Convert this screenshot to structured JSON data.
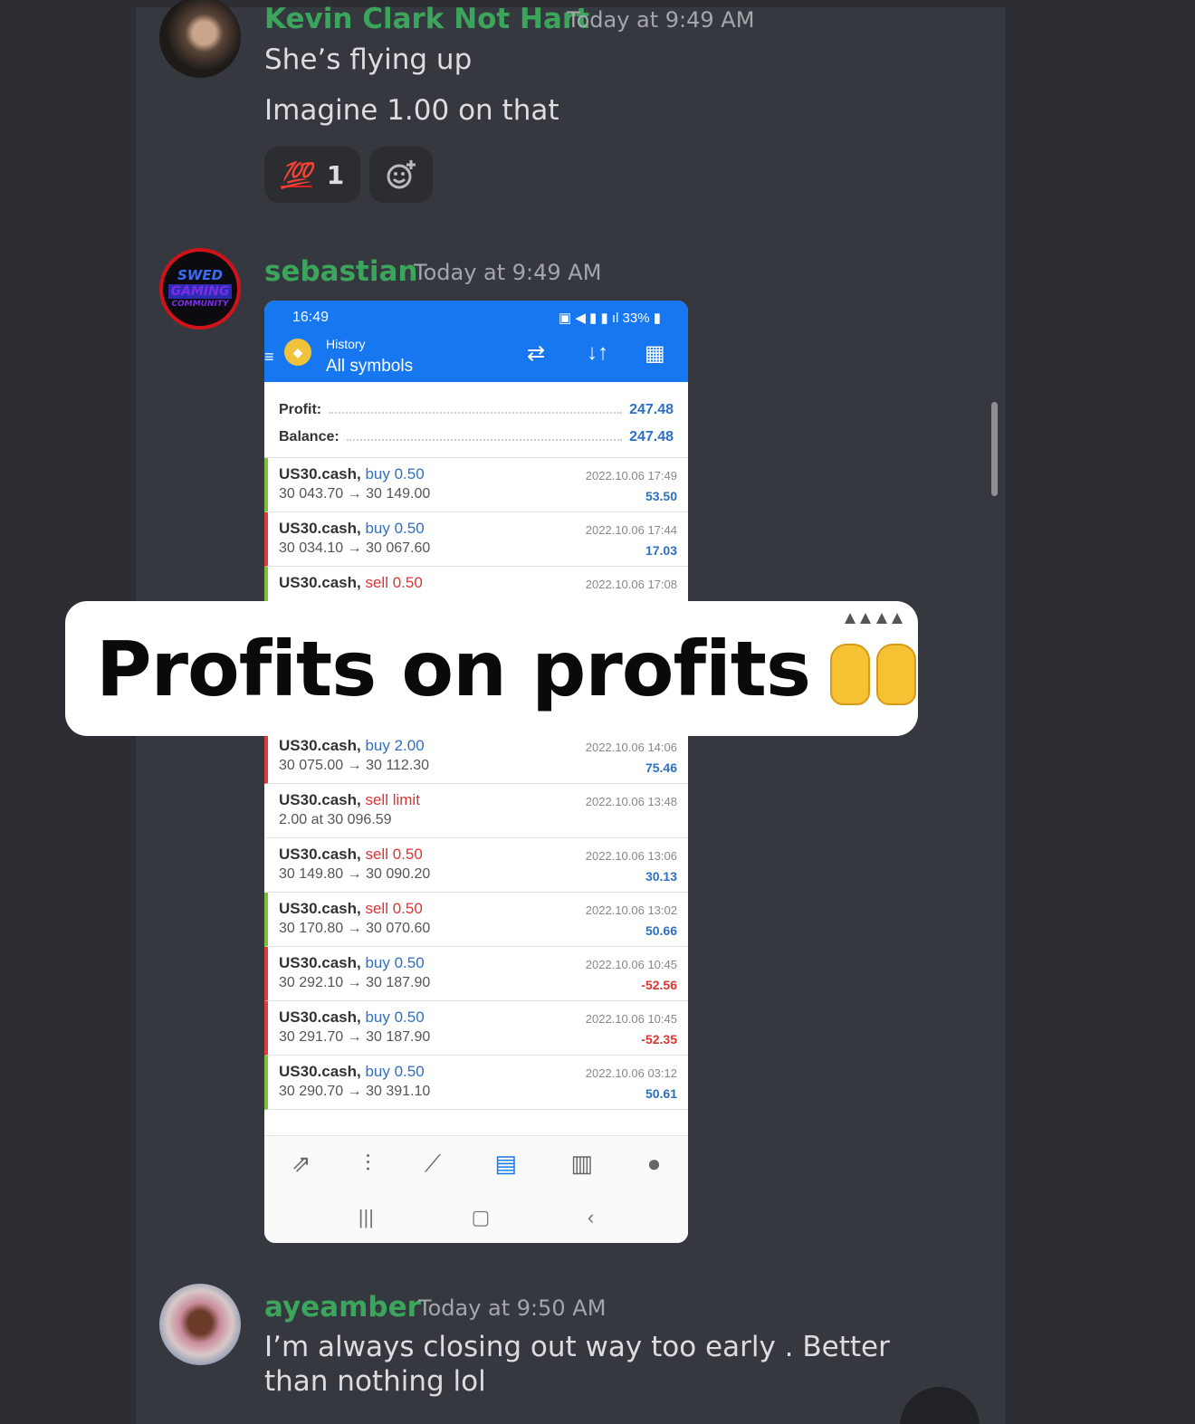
{
  "messages": [
    {
      "author": "Kevin Clark Not Hart",
      "timestamp": "Today at 9:49 AM",
      "lines": [
        "She’s flying up",
        "Imagine 1.00 on that"
      ],
      "reactions": [
        {
          "emoji": "💯",
          "count": "1"
        }
      ],
      "add_reaction_icon": "add-reaction-icon"
    },
    {
      "author": "sebastian",
      "timestamp": "Today at 9:49 AM",
      "avatar_text": [
        "SWED",
        "GAMING",
        "COMMUNITY"
      ]
    },
    {
      "author": "ayeamber",
      "timestamp": "Today at 9:50 AM",
      "lines": [
        "I’m always closing out way too early . Better than nothing lol"
      ]
    }
  ],
  "phone": {
    "status_time": "16:49",
    "status_right": "33%",
    "header_sub": "History",
    "header_title": "All symbols",
    "summary": [
      {
        "label": "Profit:",
        "value": "247.48"
      },
      {
        "label": "Balance:",
        "value": "247.48"
      }
    ],
    "trades_top": [
      {
        "symbol": "US30.cash,",
        "side": "buy 0.50",
        "dir": "buy",
        "prices": "30 043.70 → 30 149.00",
        "date": "2022.10.06 17:49",
        "profit": "53.50",
        "sign": "pos",
        "bar": "green"
      },
      {
        "symbol": "US30.cash,",
        "side": "buy 0.50",
        "dir": "buy",
        "prices": "30 034.10 → 30 067.60",
        "date": "2022.10.06 17:44",
        "profit": "17.03",
        "sign": "pos",
        "bar": "red"
      },
      {
        "symbol": "US30.cash,",
        "side": "sell 0.50",
        "dir": "sell",
        "prices": "",
        "date": "2022.10.06 17:08",
        "profit": "",
        "sign": "pos",
        "bar": "green"
      }
    ],
    "trades_bottom": [
      {
        "symbol": "US30.cash,",
        "side": "buy 2.00",
        "dir": "buy",
        "prices": "30 075.00 → 30 112.30",
        "date": "2022.10.06 14:06",
        "profit": "75.46",
        "sign": "pos",
        "bar": "red"
      },
      {
        "symbol": "US30.cash,",
        "side": "sell limit",
        "dir": "sell",
        "prices": "2.00 at 30 096.59",
        "date": "2022.10.06 13:48",
        "profit": "",
        "sign": "pos",
        "bar": "none"
      },
      {
        "symbol": "US30.cash,",
        "side": "sell 0.50",
        "dir": "sell",
        "prices": "30 149.80 → 30 090.20",
        "date": "2022.10.06 13:06",
        "profit": "30.13",
        "sign": "pos",
        "bar": "none"
      },
      {
        "symbol": "US30.cash,",
        "side": "sell 0.50",
        "dir": "sell",
        "prices": "30 170.80 → 30 070.60",
        "date": "2022.10.06 13:02",
        "profit": "50.66",
        "sign": "pos",
        "bar": "green"
      },
      {
        "symbol": "US30.cash,",
        "side": "buy 0.50",
        "dir": "buy",
        "prices": "30 292.10 → 30 187.90",
        "date": "2022.10.06 10:45",
        "profit": "-52.56",
        "sign": "neg",
        "bar": "red"
      },
      {
        "symbol": "US30.cash,",
        "side": "buy 0.50",
        "dir": "buy",
        "prices": "30 291.70 → 30 187.90",
        "date": "2022.10.06 10:45",
        "profit": "-52.35",
        "sign": "neg",
        "bar": "red"
      },
      {
        "symbol": "US30.cash,",
        "side": "buy 0.50",
        "dir": "buy",
        "prices": "30 290.70 → 30 391.10",
        "date": "2022.10.06 03:12",
        "profit": "50.61",
        "sign": "pos",
        "bar": "green"
      }
    ],
    "bottom_tabs": [
      "quotes-icon",
      "chart-icon",
      "trade-icon",
      "history-icon",
      "news-icon",
      "chat-icon"
    ],
    "active_tab": "history-icon"
  },
  "overlay": {
    "caption": "Profits on profits",
    "emoji": "raising-hands-icon"
  },
  "colors": {
    "username": "#3ba55c",
    "buy": "#2f6fc4",
    "sell": "#dd3333",
    "header": "#1677f0"
  }
}
